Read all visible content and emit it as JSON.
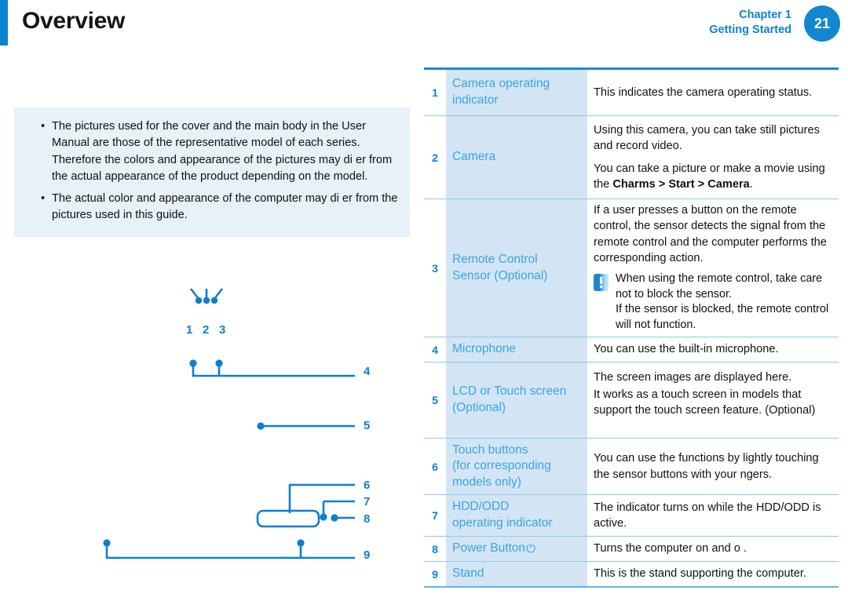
{
  "header": {
    "title": "Overview",
    "chapter": "Chapter 1",
    "section": "Getting Started",
    "page_number": "21",
    "accent_color": "#0a84d0",
    "badge_color": "#1386ce"
  },
  "note_box": {
    "bullet": "•",
    "items": [
      "The pictures used for the cover and the main body in the User Manual are those of the representative model of each series. Therefore the colors and appearance of the pictures may di er from the actual appearance of the product depending on the model.",
      "The actual color and appearance of the computer may di er from the pictures used in this guide."
    ]
  },
  "diagram": {
    "callouts": [
      "1",
      "2",
      "3",
      "4",
      "5",
      "6",
      "7",
      "8",
      "9"
    ],
    "line_color": "#0d7fd0"
  },
  "table": {
    "rows": [
      {
        "num": "1",
        "label": "Camera operating\nindicator",
        "label_lines": [
          "Camera operating",
          "indicator"
        ],
        "desc": "This indicates the camera operating status."
      },
      {
        "num": "2",
        "label": "Camera",
        "label_lines": [
          "Camera"
        ],
        "desc_p1": "Using this camera, you can take still pictures and record video.",
        "desc_p2_pre": "You can take a picture or make a movie using the ",
        "desc_p2_bold": "Charms > Start > Camera",
        "desc_p2_post": "."
      },
      {
        "num": "3",
        "label": "Remote Control\nSensor (Optional)",
        "label_lines": [
          "Remote Control",
          "Sensor (Optional)"
        ],
        "desc": "If a user presses a button on the remote control, the sensor detects the signal from the remote control and the computer performs the corresponding action.",
        "caution": "When using the remote control, take care not to block the sensor.\nIf the sensor is blocked, the remote control will not function.",
        "caution_lines": [
          "When using the remote control, take care not to block the sensor.",
          "If the sensor is blocked, the remote control will not function."
        ]
      },
      {
        "num": "4",
        "label": "Microphone",
        "label_lines": [
          "Microphone"
        ],
        "desc": "You can use the built-in microphone."
      },
      {
        "num": "5",
        "label": "LCD or Touch screen\n(Optional)",
        "label_lines": [
          "LCD or Touch screen",
          "(Optional)"
        ],
        "desc_p1": "The screen images are displayed here.",
        "desc_p2": "It works as a touch screen in models that support the touch screen feature. (Optional)"
      },
      {
        "num": "6",
        "label": "Touch buttons\n(for corresponding\nmodels only)",
        "label_lines": [
          "Touch buttons",
          "(for corresponding",
          "models only)"
        ],
        "desc": "You can use the functions by lightly touching the sensor buttons with your  ngers."
      },
      {
        "num": "7",
        "label": "HDD/ODD\noperating indicator",
        "label_lines": [
          "HDD/ODD",
          "operating indicator"
        ],
        "desc": "The indicator turns on while the HDD/ODD is active."
      },
      {
        "num": "8",
        "label": "Power Button",
        "label_lines": [
          "Power Button"
        ],
        "power_icon": "⏻",
        "desc": "Turns the computer on and o ."
      },
      {
        "num": "9",
        "label": "Stand",
        "label_lines": [
          "Stand"
        ],
        "desc": "This is the stand supporting the computer."
      }
    ]
  }
}
